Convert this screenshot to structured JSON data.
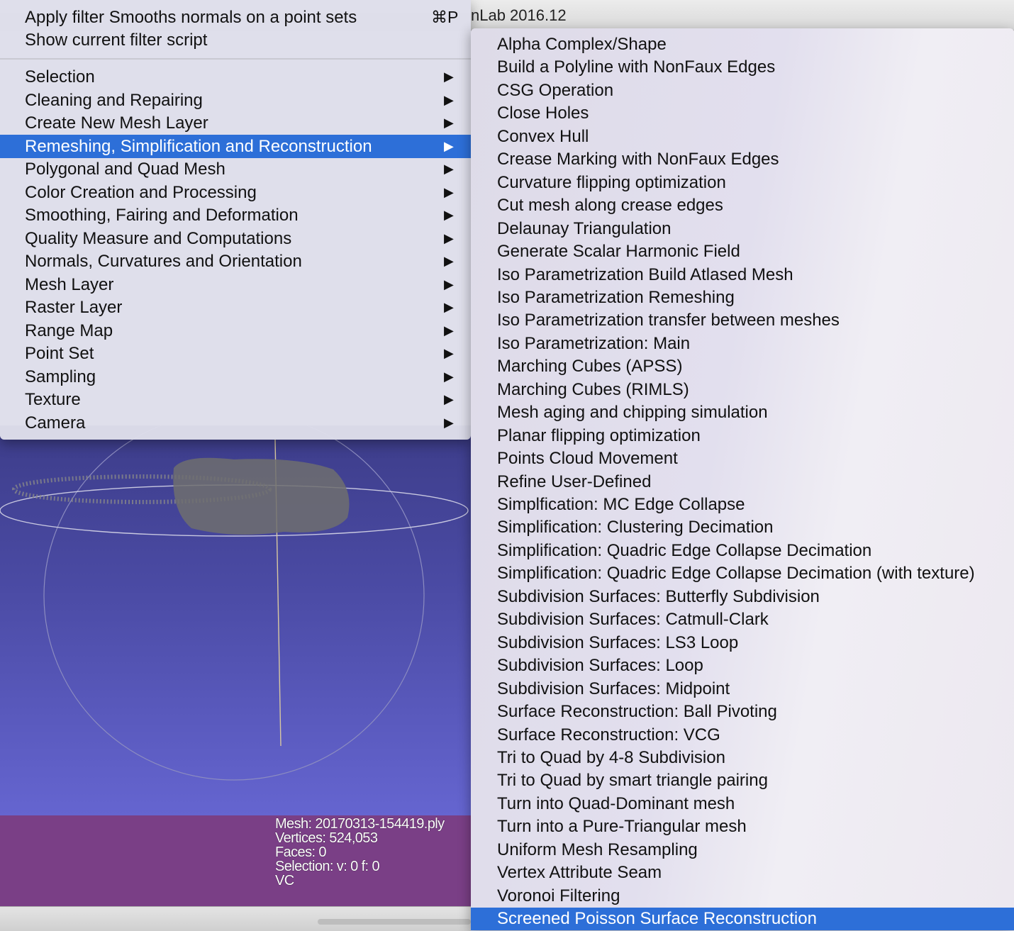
{
  "app": {
    "title": "nLab 2016.12"
  },
  "main_menu": {
    "top_items": [
      {
        "label": "Apply filter Smooths normals on a point sets",
        "shortcut": "⌘P"
      },
      {
        "label": "Show current filter script"
      }
    ],
    "categories": [
      {
        "label": "Selection"
      },
      {
        "label": "Cleaning and Repairing"
      },
      {
        "label": "Create New Mesh Layer"
      },
      {
        "label": "Remeshing, Simplification and Reconstruction",
        "highlighted": true
      },
      {
        "label": "Polygonal and Quad Mesh"
      },
      {
        "label": "Color Creation and Processing"
      },
      {
        "label": "Smoothing, Fairing and Deformation"
      },
      {
        "label": "Quality Measure and Computations"
      },
      {
        "label": "Normals, Curvatures and Orientation"
      },
      {
        "label": "Mesh Layer"
      },
      {
        "label": "Raster Layer"
      },
      {
        "label": "Range Map"
      },
      {
        "label": "Point Set"
      },
      {
        "label": "Sampling"
      },
      {
        "label": "Texture"
      },
      {
        "label": "Camera"
      }
    ],
    "submenu_arrow": "▶"
  },
  "submenu": {
    "items": [
      "Alpha Complex/Shape",
      "Build a Polyline with NonFaux Edges",
      "CSG Operation",
      "Close Holes",
      "Convex Hull",
      "Crease Marking with NonFaux Edges",
      "Curvature flipping optimization",
      "Cut mesh along crease edges",
      "Delaunay Triangulation",
      "Generate Scalar Harmonic Field",
      "Iso Parametrization Build Atlased Mesh",
      "Iso Parametrization Remeshing",
      "Iso Parametrization transfer between meshes",
      "Iso Parametrization: Main",
      "Marching Cubes (APSS)",
      "Marching Cubes (RIMLS)",
      "Mesh aging and chipping simulation",
      "Planar flipping optimization",
      "Points Cloud Movement",
      "Refine User-Defined",
      "Simplfication: MC Edge Collapse",
      "Simplification: Clustering Decimation",
      "Simplification: Quadric Edge Collapse Decimation",
      "Simplification: Quadric Edge Collapse Decimation (with texture)",
      "Subdivision Surfaces: Butterfly Subdivision",
      "Subdivision Surfaces: Catmull-Clark",
      "Subdivision Surfaces: LS3 Loop",
      "Subdivision Surfaces: Loop",
      "Subdivision Surfaces: Midpoint",
      "Surface Reconstruction: Ball Pivoting",
      "Surface Reconstruction: VCG",
      "Tri to Quad by 4-8 Subdivision",
      "Tri to Quad by smart triangle pairing",
      "Turn into Quad-Dominant mesh",
      "Turn into a Pure-Triangular mesh",
      "Uniform Mesh Resampling",
      "Vertex Attribute Seam",
      "Voronoi Filtering",
      "Screened Poisson Surface Reconstruction"
    ],
    "highlighted_index": 38
  },
  "mesh_info": {
    "mesh": "Mesh: 20170313-154419.ply",
    "vertices": "Vertices: 524,053",
    "faces": "Faces: 0",
    "selection": "Selection: v: 0 f: 0",
    "vc": "VC"
  },
  "colors": {
    "highlight": "#2d6fd8",
    "info_box": "#7a3f86"
  }
}
